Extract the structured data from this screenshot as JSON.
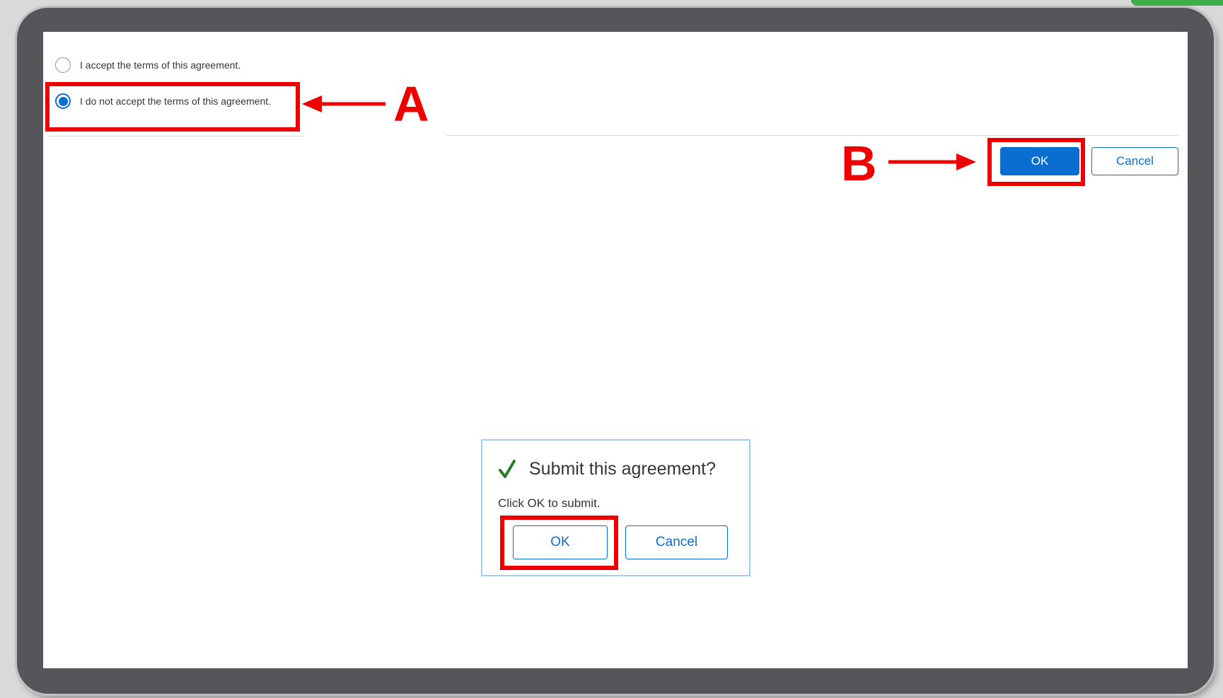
{
  "agreement": {
    "options": [
      {
        "label": "I accept the terms of this agreement.",
        "selected": false
      },
      {
        "label": "I do not accept the terms of this agreement.",
        "selected": true
      }
    ]
  },
  "toolbar": {
    "ok_label": "OK",
    "cancel_label": "Cancel"
  },
  "dialog": {
    "title": "Submit this agreement?",
    "message": "Click OK to submit.",
    "ok_label": "OK",
    "cancel_label": "Cancel",
    "icon": "checkmark-icon"
  },
  "annotations": {
    "label_a": "A",
    "label_b": "B",
    "color": "#ee0000"
  },
  "colors": {
    "accent": "#0a6ed1",
    "frame": "#55565a",
    "success": "#2b7d2b"
  }
}
